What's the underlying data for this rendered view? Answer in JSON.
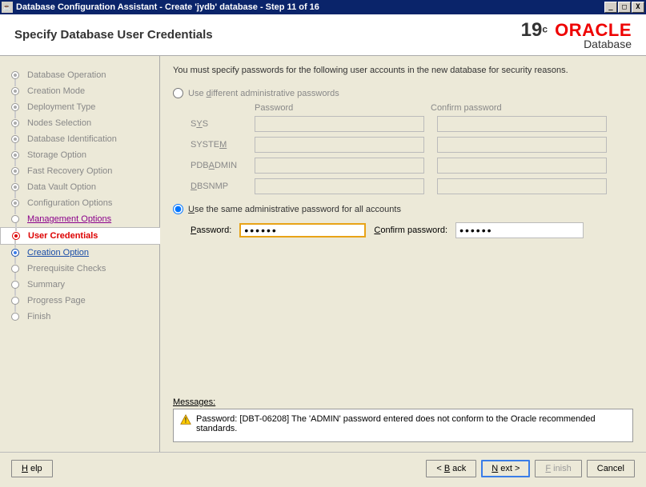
{
  "window": {
    "title": "Database Configuration Assistant - Create 'jydb' database - Step 11 of 16"
  },
  "header": {
    "title": "Specify Database User Credentials",
    "logo_version": "19",
    "logo_c": "c",
    "logo_brand": "ORACLE",
    "logo_sub": "Database"
  },
  "sidebar": {
    "items": [
      {
        "label": "Database Operation",
        "state": "done"
      },
      {
        "label": "Creation Mode",
        "state": "done"
      },
      {
        "label": "Deployment Type",
        "state": "done"
      },
      {
        "label": "Nodes Selection",
        "state": "done"
      },
      {
        "label": "Database Identification",
        "state": "done"
      },
      {
        "label": "Storage Option",
        "state": "done"
      },
      {
        "label": "Fast Recovery Option",
        "state": "done"
      },
      {
        "label": "Data Vault Option",
        "state": "done"
      },
      {
        "label": "Configuration Options",
        "state": "done"
      },
      {
        "label": "Management Options",
        "state": "link"
      },
      {
        "label": "User Credentials",
        "state": "current"
      },
      {
        "label": "Creation Option",
        "state": "next"
      },
      {
        "label": "Prerequisite Checks",
        "state": "pending"
      },
      {
        "label": "Summary",
        "state": "pending"
      },
      {
        "label": "Progress Page",
        "state": "pending"
      },
      {
        "label": "Finish",
        "state": "pending"
      }
    ]
  },
  "main": {
    "intro": "You must specify passwords for the following user accounts in the new database for security reasons.",
    "radio_different": "Use different administrative passwords",
    "radio_same": "Use the same administrative password for all accounts",
    "col_password": "Password",
    "col_confirm": "Confirm password",
    "rows": [
      {
        "label_pre": "S",
        "label_u": "Y",
        "label_post": "S"
      },
      {
        "label_pre": "SYSTE",
        "label_u": "M",
        "label_post": ""
      },
      {
        "label_pre": "PDB",
        "label_u": "A",
        "label_post": "DMIN"
      },
      {
        "label_pre": "",
        "label_u": "D",
        "label_post": "BSNMP"
      }
    ],
    "same_password_label": "Password:",
    "same_confirm_label": "Confirm password:",
    "password_value": "••••••",
    "confirm_value": "••••••",
    "messages_label": "Messages:",
    "message_text": "Password: [DBT-06208] The 'ADMIN' password entered does not conform to the Oracle recommended standards."
  },
  "footer": {
    "help": "Help",
    "back": "Back",
    "next": "Next",
    "finish": "Finish",
    "cancel": "Cancel"
  }
}
